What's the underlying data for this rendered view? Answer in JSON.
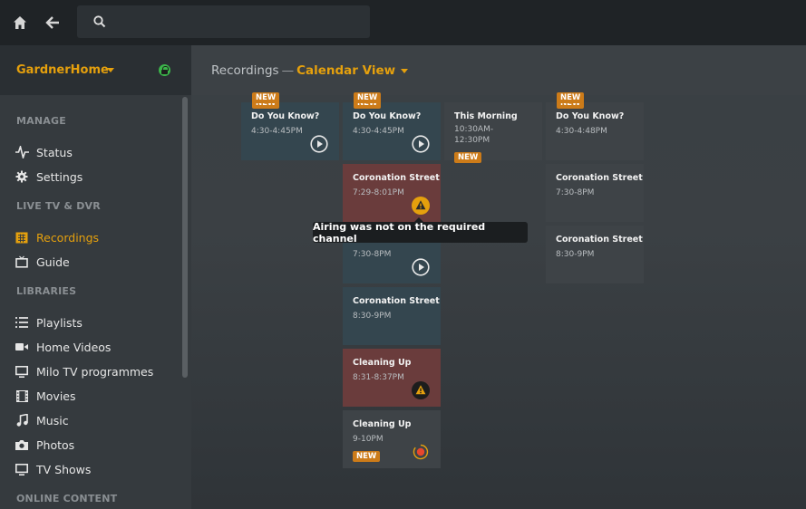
{
  "topbar": {
    "home_icon": "home-icon",
    "back_icon": "back-arrow-icon",
    "search_icon": "search-icon",
    "search_placeholder": ""
  },
  "server": {
    "name": "GardnerHome",
    "lock_icon": "lock-icon",
    "accent": "#e5a00d"
  },
  "sidebar": {
    "sections": [
      {
        "heading": "MANAGE",
        "items": [
          {
            "label": "Status",
            "icon": "activity-icon"
          },
          {
            "label": "Settings",
            "icon": "gear-icon"
          }
        ]
      },
      {
        "heading": "LIVE TV & DVR",
        "items": [
          {
            "label": "Recordings",
            "icon": "calendar-icon",
            "active": true
          },
          {
            "label": "Guide",
            "icon": "tv-icon"
          }
        ]
      },
      {
        "heading": "LIBRARIES",
        "items": [
          {
            "label": "Playlists",
            "icon": "list-icon"
          },
          {
            "label": "Home Videos",
            "icon": "video-camera-icon"
          },
          {
            "label": "Milo TV programmes",
            "icon": "monitor-icon"
          },
          {
            "label": "Movies",
            "icon": "film-icon"
          },
          {
            "label": "Music",
            "icon": "music-note-icon"
          },
          {
            "label": "Photos",
            "icon": "camera-icon"
          },
          {
            "label": "TV Shows",
            "icon": "monitor-icon"
          }
        ]
      },
      {
        "heading": "ONLINE CONTENT",
        "items": []
      }
    ]
  },
  "header": {
    "section": "Recordings",
    "separator": "—",
    "view": "Calendar View"
  },
  "tooltip": "Airing was not on the required channel",
  "cards": {
    "c1": {
      "title": "Do You Know?",
      "time": "4:30-4:45PM",
      "top_badge": "NEW"
    },
    "c2": {
      "title": "Do You Know?",
      "time": "4:30-4:45PM",
      "top_badge": "NEW"
    },
    "c3": {
      "title": "This Morning",
      "time_line1": "10:30AM-",
      "time_line2": "12:30PM",
      "badge": "NEW"
    },
    "c4": {
      "title": "Do You Know?",
      "time": "4:30-4:48PM",
      "top_badge": "NEW"
    },
    "c5": {
      "title": "Coronation Street",
      "time": "7:29-8:01PM"
    },
    "c6": {
      "title": "Coronation Street",
      "time": "7:30-8PM"
    },
    "c7": {
      "title": "Coronation Street",
      "time": "7:30-8PM"
    },
    "c8": {
      "title": "Coronation Street",
      "time": "8:30-9PM"
    },
    "c9": {
      "title": "Coronation Street",
      "time": "8:30-9PM"
    },
    "c10": {
      "title": "Cleaning Up",
      "time": "8:31-8:37PM"
    },
    "c11": {
      "title": "Cleaning Up",
      "time": "9-10PM",
      "badge": "NEW"
    }
  }
}
